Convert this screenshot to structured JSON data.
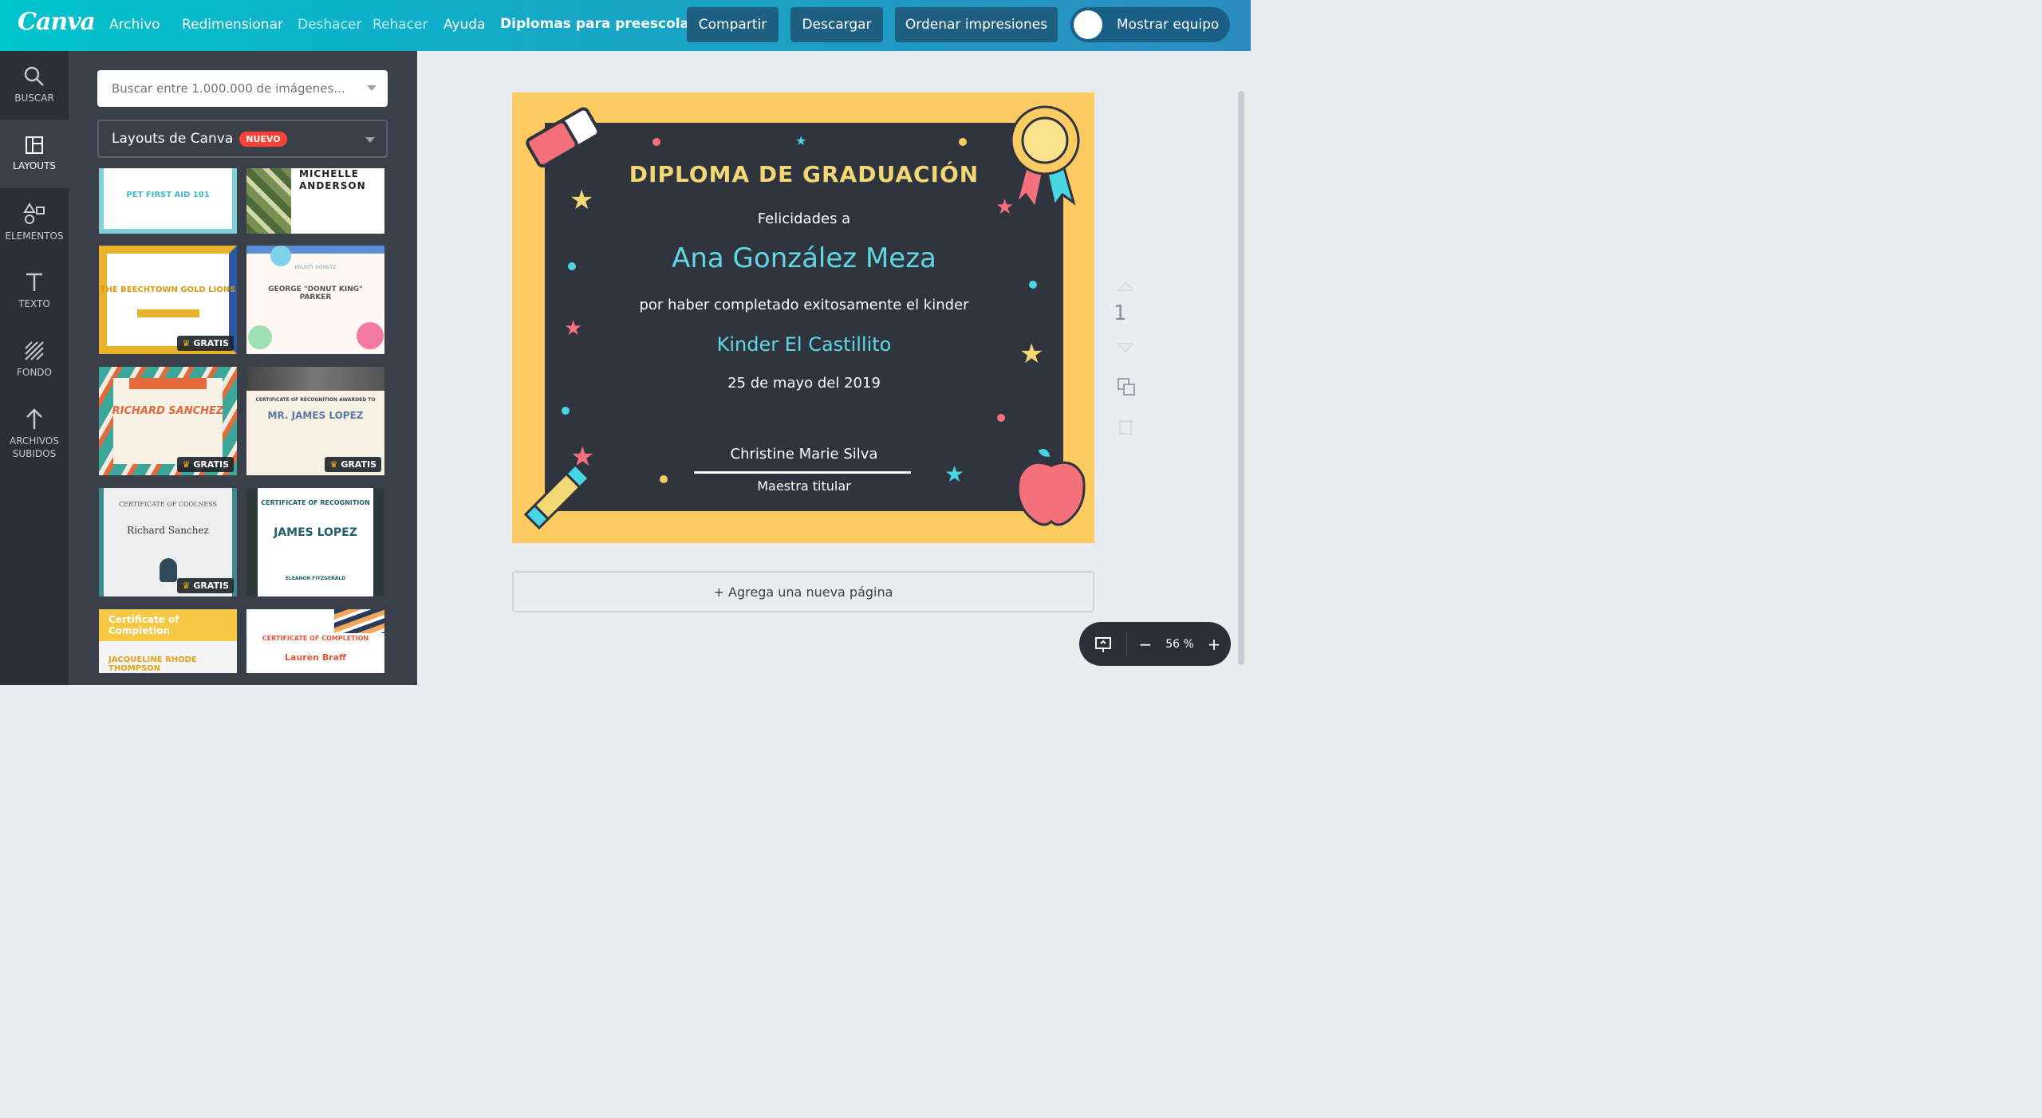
{
  "topbar": {
    "logo": "Canva",
    "menu": [
      "Archivo",
      "Redimensionar",
      "Deshacer",
      "Rehacer",
      "Ayuda"
    ],
    "doc_title": "Diplomas para preescolar",
    "share": "Compartir",
    "download": "Descargar",
    "print": "Ordenar impresiones",
    "team": "Mostrar equipo"
  },
  "rail": {
    "items": [
      {
        "label": "BUSCAR",
        "icon": "search-icon"
      },
      {
        "label": "LAYOUTS",
        "icon": "layouts-icon"
      },
      {
        "label": "ELEMENTOS",
        "icon": "elements-icon"
      },
      {
        "label": "TEXTO",
        "icon": "text-icon"
      },
      {
        "label": "FONDO",
        "icon": "background-icon"
      },
      {
        "label": "ARCHIVOS\nSUBIDOS",
        "icon": "upload-icon"
      }
    ]
  },
  "panel": {
    "search_placeholder": "Buscar entre 1.000.000 de imágenes...",
    "layout_select": "Layouts de Canva",
    "badge": "NUEVO",
    "gratis": "GRATIS",
    "thumbs": [
      {
        "title": "PET FIRST AID 101"
      },
      {
        "title": "MICHELLE ANDERSON"
      },
      {
        "title": "THE BEECHTOWN GOLD LIONS"
      },
      {
        "title": "GEORGE \"DONUT KING\" PARKER"
      },
      {
        "title": "RICHARD SANCHEZ"
      },
      {
        "title": "MR. JAMES LOPEZ"
      },
      {
        "title": "Richard Sanchez"
      },
      {
        "title": "JAMES LOPEZ"
      },
      {
        "title": "JACQUELINE RHODE THOMPSON"
      },
      {
        "title": "Lauren Braff"
      }
    ],
    "thumb_sub": {
      "coolness_header": "CERTIFICATE OF COOLNESS",
      "recognition_header": "CERTIFICATE OF RECOGNITION AWARDED TO",
      "recognition2": "CERTIFICATE OF RECOGNITION",
      "completion": "Certificate of Completion",
      "completion2": "CERTIFICATE OF COMPLETION",
      "krusty": "KRUSTY DONUTZ",
      "eleanor": "ELEANOR FITZGERALD"
    }
  },
  "diploma": {
    "title": "DIPLOMA DE GRADUACIÓN",
    "greeting": "Felicidades a",
    "name": "Ana González Meza",
    "reason": "por haber completado exitosamente el kinder",
    "school": "Kinder El Castillito",
    "date": "25 de mayo del 2019",
    "signer": "Christine Marie Silva",
    "role": "Maestra titular"
  },
  "canvas": {
    "add_page": "+ Agrega una nueva página",
    "page_number": "1",
    "zoom": "56 %"
  },
  "colors": {
    "accent": "#00c4cc",
    "frame": "#fecb62",
    "board": "#2f343f",
    "cyan_text": "#5fd8e4",
    "gold_text": "#f2d774"
  }
}
